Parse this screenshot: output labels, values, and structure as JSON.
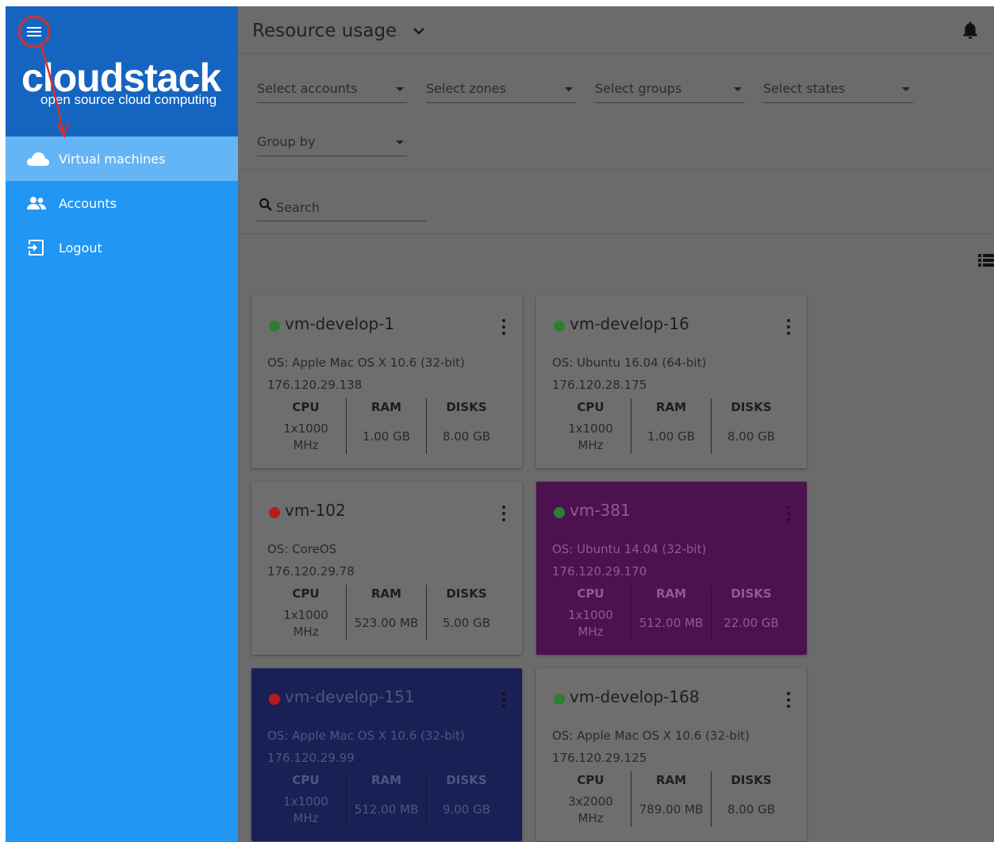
{
  "sidebar": {
    "logo": "cloudstack",
    "tagline": "open source cloud computing",
    "items": [
      {
        "label": "Virtual machines",
        "icon": "cloud-icon",
        "active": true
      },
      {
        "label": "Accounts",
        "icon": "people-icon",
        "active": false
      },
      {
        "label": "Logout",
        "icon": "logout-icon",
        "active": false
      }
    ]
  },
  "header": {
    "title": "Resource usage"
  },
  "filters": {
    "accounts": "Select accounts",
    "zones": "Select zones",
    "groups": "Select groups",
    "states": "Select states",
    "group_by": "Group by"
  },
  "search": {
    "placeholder": "Search"
  },
  "labels": {
    "cpu": "CPU",
    "ram": "RAM",
    "disks": "DISKS"
  },
  "cards": [
    {
      "name": "vm-develop-1",
      "state_color": "#2e7d32",
      "os": "OS: Apple Mac OS X 10.6 (32-bit)",
      "ip": "176.120.29.138",
      "cpu_line1": "1x1000",
      "cpu_line2": "MHz",
      "ram": "1.00 GB",
      "disks": "8.00 GB"
    },
    {
      "name": "vm-develop-16",
      "state_color": "#2e7d32",
      "os": "OS: Ubuntu 16.04 (64-bit)",
      "ip": "176.120.28.175",
      "cpu_line1": "1x1000",
      "cpu_line2": "MHz",
      "ram": "1.00 GB",
      "disks": "8.00 GB"
    },
    {
      "name": "vm-102",
      "state_color": "#b71c1c",
      "os": "OS: CoreOS",
      "ip": "176.120.29.78",
      "cpu_line1": "1x1000",
      "cpu_line2": "MHz",
      "ram": "523.00 MB",
      "disks": "5.00 GB"
    },
    {
      "name": "vm-381",
      "state_color": "#2e7d32",
      "os": "OS: Ubuntu 14.04 (32-bit)",
      "ip": "176.120.29.170",
      "cpu_line1": "1x1000",
      "cpu_line2": "MHz",
      "ram": "512.00 MB",
      "disks": "22.00 GB"
    },
    {
      "name": "vm-develop-151",
      "state_color": "#b71c1c",
      "os": "OS: Apple Mac OS X 10.6 (32-bit)",
      "ip": "176.120.29.99",
      "cpu_line1": "1x1000",
      "cpu_line2": "MHz",
      "ram": "512.00 MB",
      "disks": "9.00 GB"
    },
    {
      "name": "vm-develop-168",
      "state_color": "#2e7d32",
      "os": "OS: Apple Mac OS X 10.6 (32-bit)",
      "ip": "176.120.29.125",
      "cpu_line1": "3x2000",
      "cpu_line2": "MHz",
      "ram": "789.00 MB",
      "disks": "8.00 GB"
    }
  ],
  "colors": {
    "sidebar": "#2196f3",
    "sidebar_header": "#1565c0",
    "sidebar_active": "#64b5f6",
    "overlay": "#6b6b6b",
    "annotation": "#d32f2f"
  }
}
